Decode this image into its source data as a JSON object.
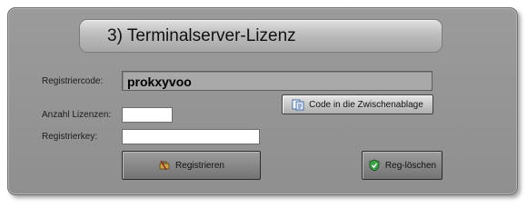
{
  "title": "3) Terminalserver-Lizenz",
  "labels": {
    "registriercode": "Registriercode:",
    "anzahl_lizenzen": "Anzahl Lizenzen:",
    "registrierkey": "Registrierkey:"
  },
  "fields": {
    "registriercode_value": "prokxyvoo",
    "anzahl_lizenzen_value": "",
    "registrierkey_value": ""
  },
  "buttons": {
    "copy_code": "Code in die Zwischenablage",
    "registrieren": "Registrieren",
    "reg_loeschen": "Reg-löschen"
  },
  "icons": {
    "copy_code": "clipboard-icon",
    "registrieren": "tools-icon",
    "reg_loeschen": "shield-check-icon"
  }
}
